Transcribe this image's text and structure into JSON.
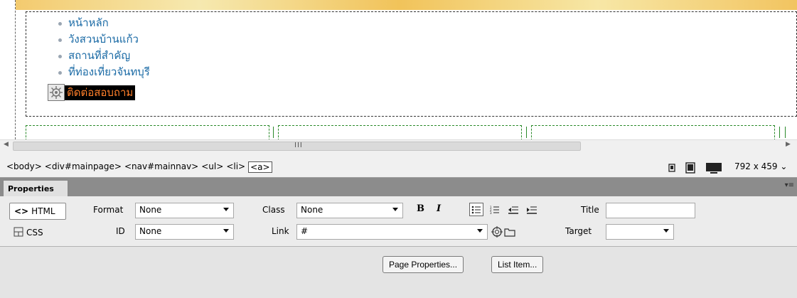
{
  "nav": {
    "items": [
      "หน้าหลัก",
      "วังสวนบ้านแก้ว",
      "สถานที่สำคัญ",
      "ที่ท่องเที่ยวจันทบุรี"
    ],
    "selected_item": "ติดต่อสอบถาม"
  },
  "scrollbar": {
    "grip": "III"
  },
  "status": {
    "tags": [
      "<body>",
      "<div#mainpage>",
      "<nav#mainnav>",
      "<ul>",
      "<li>",
      "<a>"
    ],
    "window_size": "792 x 459"
  },
  "properties": {
    "tab": "Properties",
    "html_btn": "HTML",
    "css_btn": "CSS",
    "format_label": "Format",
    "format_value": "None",
    "id_label": "ID",
    "id_value": "None",
    "class_label": "Class",
    "class_value": "None",
    "link_label": "Link",
    "link_value": "#",
    "title_label": "Title",
    "title_value": "",
    "target_label": "Target",
    "target_value": "",
    "bold": "B",
    "italic": "I",
    "page_properties_btn": "Page Properties...",
    "list_item_btn": "List Item..."
  },
  "colors": {
    "link": "#1a6aa5",
    "selected_text": "#ff7f2a",
    "panel_header": "#8c8c8c"
  }
}
